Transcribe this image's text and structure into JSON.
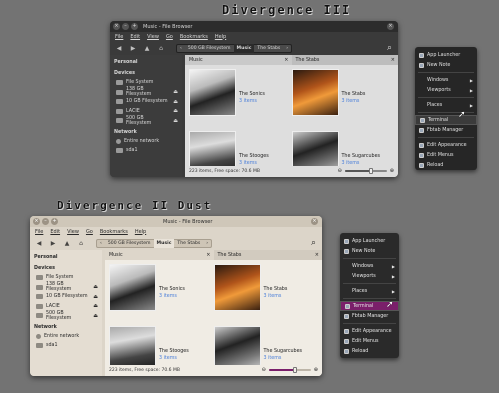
{
  "heading_top": "Divergence III",
  "heading_bottom": "Divergence II Dust",
  "window": {
    "title": "Music - File Browser",
    "menu": [
      "File",
      "Edit",
      "View",
      "Go",
      "Bookmarks",
      "Help"
    ],
    "breadcrumb": [
      "500 GB Filesystem",
      "Music",
      "The Stabs"
    ],
    "sidebar": {
      "personal_label": "Personal",
      "devices_label": "Devices",
      "devices": [
        "File System",
        "138 GB Filesystem",
        "10 GB Filesystem",
        "LACIE",
        "500 GB Filesystem"
      ],
      "network_label": "Network",
      "network": [
        "Entire network",
        "sda1"
      ]
    },
    "panes": [
      "Music",
      "The Stabs"
    ],
    "files": [
      {
        "name": "The Sonics",
        "count": "3 items"
      },
      {
        "name": "The Stabs",
        "count": "3 items"
      },
      {
        "name": "The Stooges",
        "count": "3 items"
      },
      {
        "name": "The Sugarcubes",
        "count": "3 items"
      }
    ],
    "status": "223 items, Free space: 70.6 MB"
  },
  "context_menu": {
    "items": [
      {
        "label": "App Launcher",
        "icon": "app-launcher-icon"
      },
      {
        "label": "New Note",
        "icon": "note-icon"
      },
      {
        "sep": true
      },
      {
        "label": "Windows",
        "submenu": true
      },
      {
        "label": "Viewports",
        "submenu": true
      },
      {
        "sep": true
      },
      {
        "label": "Places",
        "submenu": true
      },
      {
        "sep": true
      },
      {
        "label": "Terminal",
        "icon": "terminal-icon",
        "highlight": true
      },
      {
        "label": "Fbtab Manager",
        "icon": "manager-icon"
      },
      {
        "sep": true
      },
      {
        "label": "Edit Appearance",
        "icon": "appearance-icon"
      },
      {
        "label": "Edit Menus",
        "icon": "menus-icon"
      },
      {
        "label": "Reload",
        "icon": "reload-icon"
      }
    ]
  },
  "themes": {
    "dark": {
      "bg": "#3a3a3a",
      "title_bg": "#2c2c2c",
      "text": "#d8d8d8",
      "side_bg": "#3c3c3c",
      "content_bg": "#dedede",
      "pane_head": "#c9c9c9",
      "accent": "#4b7fd9",
      "menu_bg": "#262626",
      "menu_text": "#e0e0e0",
      "menu_hl": "#3b3b3b"
    },
    "dust": {
      "bg": "#dcd5c9",
      "title_bg": "#cfc7b9",
      "text": "#2b2b2b",
      "side_bg": "#e4ddd2",
      "content_bg": "#f0ece4",
      "pane_head": "#ddd6ca",
      "accent": "#4b7fd9",
      "menu_bg": "#2a2a2a",
      "menu_text": "#e6e6e6",
      "menu_hl": "#7a1f6a"
    }
  }
}
